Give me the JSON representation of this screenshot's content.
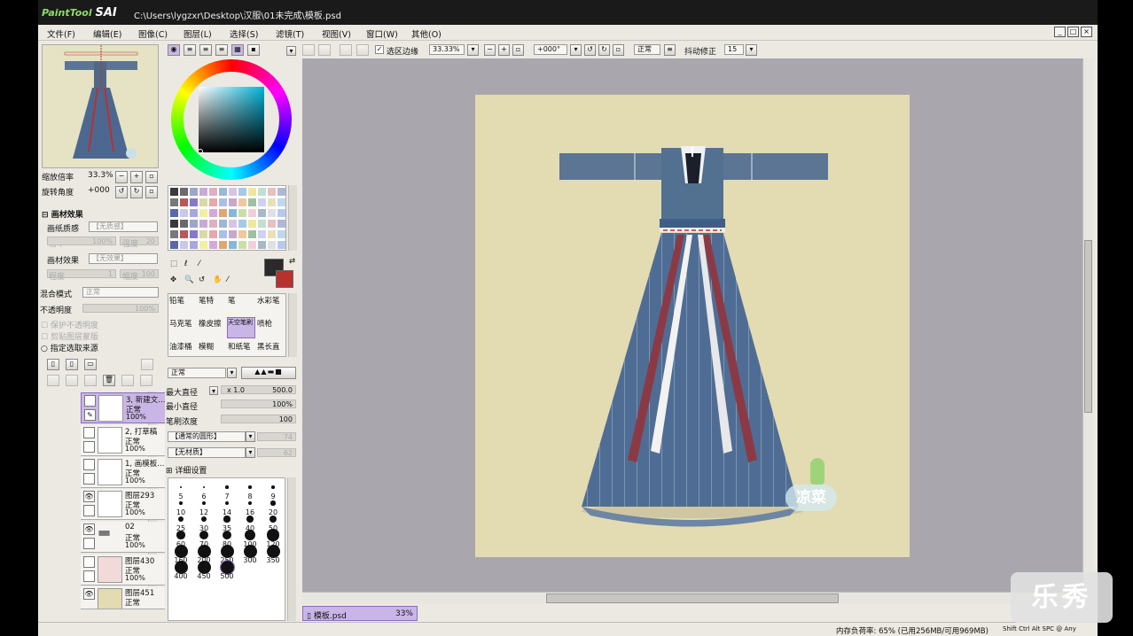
{
  "window": {
    "app_name": "PaintTool",
    "app_brand": "SAI",
    "path": "C:\\Users\\lygzxr\\Desktop\\汉服\\01未完成\\模板.psd"
  },
  "menu": [
    "文件(F)",
    "编辑(E)",
    "图像(C)",
    "图层(L)",
    "选择(S)",
    "滤镜(T)",
    "视图(V)",
    "窗口(W)",
    "其他(O)"
  ],
  "toolbar": {
    "selection_edge_label": "选区边缘",
    "zoom": "33.33%",
    "rotation": "+000°",
    "blend": "正常",
    "stabilizer_label": "抖动修正",
    "stabilizer_value": "15"
  },
  "navigator": {
    "zoom_label": "缩放倍率",
    "zoom_value": "33.3%",
    "rotate_label": "旋转角度",
    "rotate_value": "+000"
  },
  "canvas_effects": {
    "header": "画材效果",
    "paper_texture_label": "画纸质感",
    "paper_texture_value": "【无质感】",
    "scale_label": "倍率",
    "scale_value": "100%",
    "strength_label": "强度",
    "strength_value": "20",
    "material_label": "画材效果",
    "material_value": "【无效果】",
    "degree_label": "程度",
    "degree_value": "1",
    "width_label": "幅度",
    "width_value": "100"
  },
  "layer_props": {
    "blend_label": "混合模式",
    "blend_value": "正常",
    "opacity_label": "不透明度",
    "opacity_value": "100%",
    "protect_alpha": "保护不透明度",
    "clip_group": "剪贴图层蒙版",
    "source_label": "指定选取来源"
  },
  "layers": [
    {
      "name": "3, 新建文...",
      "mode": "正常",
      "opacity": "100%",
      "selected": true
    },
    {
      "name": "2, 打草稿",
      "mode": "正常",
      "opacity": "100%"
    },
    {
      "name": "1, 画模板...",
      "mode": "正常",
      "opacity": "100%"
    },
    {
      "name": "图层293",
      "mode": "正常",
      "opacity": "100%"
    },
    {
      "name": "02",
      "mode": "正常",
      "opacity": "100%"
    },
    {
      "name": "图层430",
      "mode": "正常",
      "opacity": "100%"
    },
    {
      "name": "图层451",
      "mode": "正常",
      "opacity": "100%"
    }
  ],
  "tools": [
    "铅笔",
    "笔特",
    "笔",
    "水彩笔",
    "马克笔",
    "橡皮擦",
    "天空笔刷",
    "喷枪",
    "油漆桶",
    "模糊",
    "和纸笔",
    "黑长直"
  ],
  "brush": {
    "mode": "正常",
    "max_size_label": "最大直径",
    "max_size_mult": "x 1.0",
    "max_size_value": "500.0",
    "min_size_label": "最小直径",
    "min_size_value": "100%",
    "density_label": "笔刷浓度",
    "density_value": "100",
    "shape": "【通常的圆形】",
    "shape_val": "74",
    "texture": "【无材质】",
    "texture_val": "62",
    "detail_label": "详细设置"
  },
  "brush_sizes": [
    "5",
    "6",
    "7",
    "8",
    "9",
    "10",
    "12",
    "14",
    "16",
    "20",
    "25",
    "30",
    "35",
    "40",
    "50",
    "60",
    "70",
    "80",
    "100",
    "120",
    "160",
    "200",
    "250",
    "300",
    "350",
    "400",
    "450",
    "500"
  ],
  "canvas_tab": {
    "name": "模板.psd",
    "zoom": "33%"
  },
  "watermark": "凉菜",
  "status": {
    "memory": "内存负荷率: 65% (已用256MB/可用969MB)",
    "keys": "Shift Ctrl Alt SPC @ Any"
  },
  "colors": {
    "accent": "#c9b6e6",
    "fg": "#2a2a2a",
    "bg": "#b8312f",
    "paper": "#e3dbb2",
    "robe": "#5b7592"
  }
}
